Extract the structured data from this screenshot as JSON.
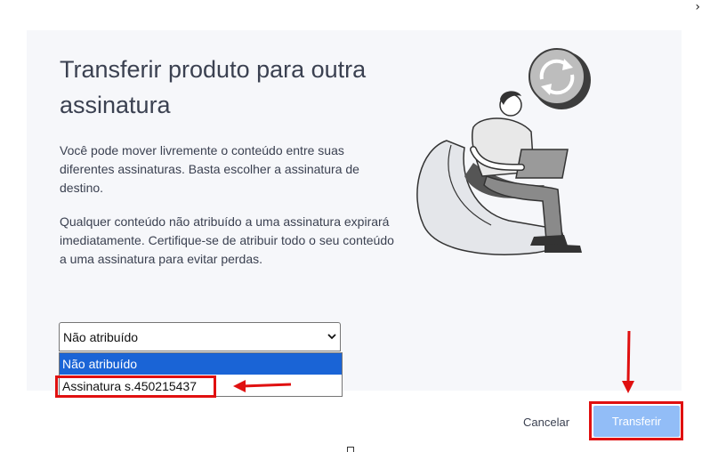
{
  "dialog": {
    "close_glyph": "›",
    "title": "Transferir produto para outra assinatura",
    "paragraph_1": "Você pode mover livremente o conteúdo entre suas diferentes assinaturas. Basta escolher a assinatura de destino.",
    "paragraph_2": "Qualquer conteúdo não atribuído a uma assinatura expirará imediatamente. Certifique-se de atribuir todo o seu conteúdo a uma assinatura para evitar perdas."
  },
  "subscription_select": {
    "selected_value": "Não atribuído",
    "options": [
      "Não atribuído",
      "Assinatura s.450215437"
    ],
    "highlighted_index": 0
  },
  "actions": {
    "cancel_label": "Cancelar",
    "transfer_label": "Transferir"
  },
  "colors": {
    "panel_bg": "#f6f7fa",
    "highlight": "#1a64d6",
    "transfer_disabled": "#92bdf7",
    "annotation_red": "#e01010"
  },
  "icons": [
    "sync-icon",
    "person-laptop-illustration",
    "chevron-down-icon",
    "arrow-left-annotation",
    "arrow-down-annotation"
  ]
}
